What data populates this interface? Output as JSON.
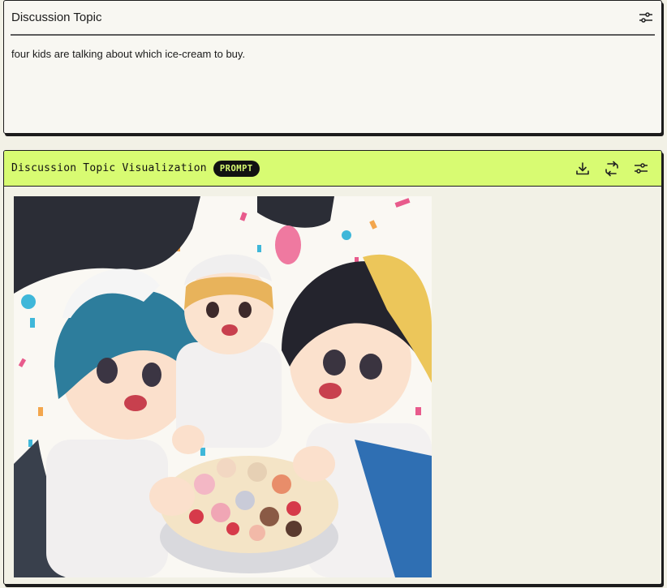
{
  "topic_panel": {
    "title": "Discussion Topic",
    "text": "four kids are talking about which ice-cream to buy.",
    "settings_icon": "sliders-icon"
  },
  "visual_panel": {
    "title": "Discussion Topic Visualization",
    "badge": "PROMPT",
    "actions": {
      "download_icon": "download-icon",
      "regenerate_icon": "repeat-icon",
      "settings_icon": "sliders-icon"
    },
    "image_alt": "Anime illustration of four kids around a big bowl of ice cream with colorful confetti",
    "colors": {
      "header_bg": "#d8fb72",
      "badge_bg": "#111111",
      "panel_bg": "#f2f1e6"
    }
  }
}
